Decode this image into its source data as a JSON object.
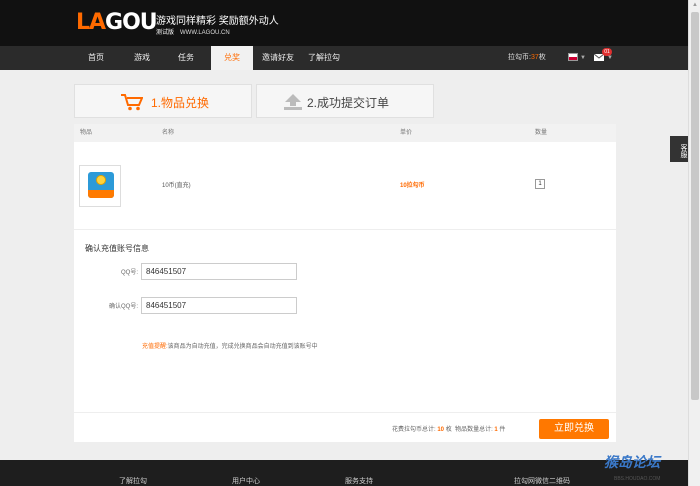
{
  "header": {
    "logo_left": "LA",
    "logo_right": "GOU",
    "tagline": "游戏同样精彩 奖励额外动人",
    "beta_label": "测试版",
    "site_url": "WWW.LAGOU.CN"
  },
  "nav": {
    "items": [
      "首页",
      "游戏",
      "任务",
      "兑奖",
      "邀请好友",
      "了解拉勾"
    ],
    "active_index": 3,
    "balance_label": "拉勾币:",
    "balance_value": "37",
    "balance_unit": "枚",
    "mail_badge": "01"
  },
  "side_service": "客服",
  "steps": {
    "step1": "1.物品兑换",
    "step2": "2.成功提交订单"
  },
  "table": {
    "headers": [
      "物品",
      "名称",
      "单价",
      "数量"
    ],
    "row": {
      "name": "10币(直充)",
      "price": "10拉勾币",
      "quantity": "1"
    }
  },
  "confirm": {
    "title": "确认充值账号信息",
    "qq_label": "QQ号:",
    "qq_value": "846451507",
    "confirm_qq_label": "确认QQ号:",
    "confirm_qq_value": "846451507",
    "notice_highlight": "充值提醒:",
    "notice_text": "该商品为自动充值，完成兑换商品会自动充值到该账号中"
  },
  "summary": {
    "cost_label": "花费拉勾币总计:",
    "cost_value": "10",
    "cost_unit": "枚",
    "count_label": "物品数量总计:",
    "count_value": "1",
    "count_unit": "件",
    "redeem_button": "立即兑换"
  },
  "footer": {
    "links": [
      "了解拉勾",
      "用户中心",
      "服务支持",
      "拉勾网微信二维码"
    ]
  },
  "watermark": {
    "top": "猴岛论坛",
    "bottom": "BBS.HOUDAO.COM"
  },
  "colors": {
    "accent": "#ff6a00",
    "header_bg": "#111111",
    "nav_bg": "#2b2b2b",
    "button": "#ff7800"
  }
}
